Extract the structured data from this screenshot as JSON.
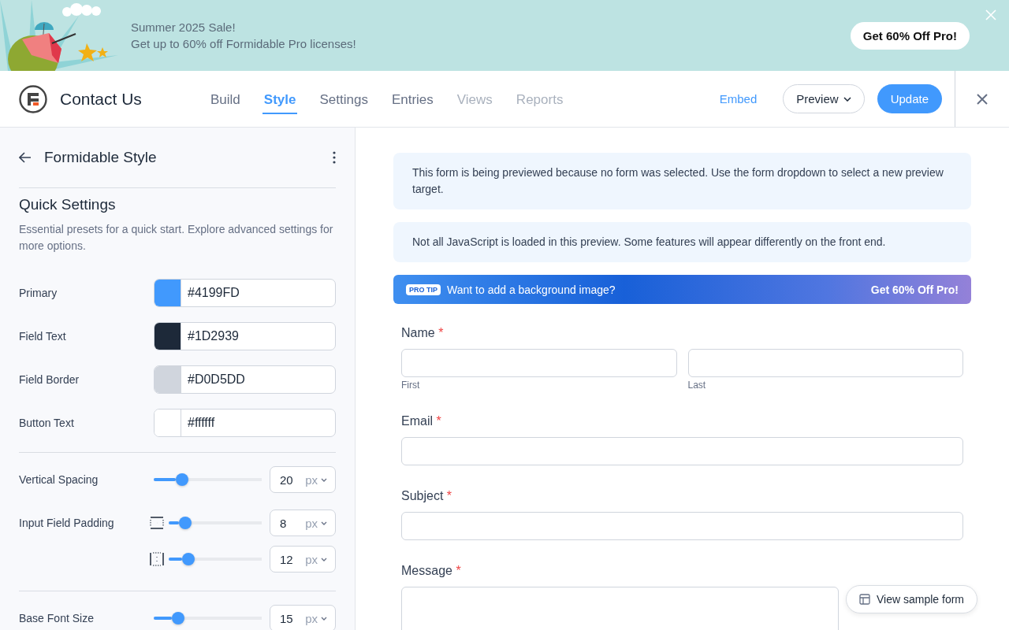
{
  "promo_banner": {
    "title": "Summer 2025 Sale!",
    "subtitle": "Get up to 60% off Formidable Pro licenses!",
    "button": "Get 60% Off Pro!"
  },
  "header": {
    "title": "Contact Us",
    "tabs": [
      {
        "label": "Build",
        "selected": false,
        "disabled": false
      },
      {
        "label": "Style",
        "selected": true,
        "disabled": false
      },
      {
        "label": "Settings",
        "selected": false,
        "disabled": false
      },
      {
        "label": "Entries",
        "selected": false,
        "disabled": false
      },
      {
        "label": "Views",
        "selected": false,
        "disabled": true
      },
      {
        "label": "Reports",
        "selected": false,
        "disabled": true
      }
    ],
    "embed": "Embed",
    "preview": "Preview",
    "update": "Update"
  },
  "sidebar": {
    "title": "Formidable Style",
    "section_title": "Quick Settings",
    "description": "Essential presets for a quick start. Explore advanced settings for more options.",
    "colors": [
      {
        "label": "Primary",
        "value": "#4199FD",
        "color": "#4199fd"
      },
      {
        "label": "Field Text",
        "value": "#1D2939",
        "color": "#1d2939"
      },
      {
        "label": "Field Border",
        "value": "#D0D5DD",
        "color": "#d0d5dd"
      },
      {
        "label": "Button Text",
        "value": "#ffffff",
        "color": "#ffffff"
      }
    ],
    "sliders": [
      {
        "label": "Vertical Spacing",
        "kind": "plain",
        "level": 0.23,
        "value": "20",
        "unit": "px"
      },
      {
        "label": "Input Field Padding",
        "kind": "vertical",
        "level": 0.13,
        "value": "8",
        "unit": "px"
      },
      {
        "kind": "horizontal",
        "level": 0.17,
        "value": "12",
        "unit": "px"
      },
      {
        "label": "Base Font Size",
        "kind": "plain",
        "level": 0.19,
        "value": "15",
        "unit": "px",
        "divider_before": true
      }
    ]
  },
  "preview": {
    "notices": [
      "This form is being previewed because no form was selected. Use the form dropdown to select a new preview target.",
      "Not all JavaScript is loaded in this preview. Some features will appear differently on the front end."
    ],
    "pro_tip": {
      "badge": "PRO TIP",
      "text": "Want to add a background image?",
      "link": "Get 60% Off Pro!"
    },
    "fields": [
      {
        "label": "Name",
        "required_mark": "*",
        "kind": "name",
        "subfields": [
          "First",
          "Last"
        ]
      },
      {
        "label": "Email",
        "required_mark": "*",
        "kind": "text"
      },
      {
        "label": "Subject",
        "required_mark": "*",
        "kind": "text"
      },
      {
        "label": "Message",
        "required_mark": "*",
        "kind": "textarea"
      }
    ],
    "sample_button": "View sample form"
  }
}
